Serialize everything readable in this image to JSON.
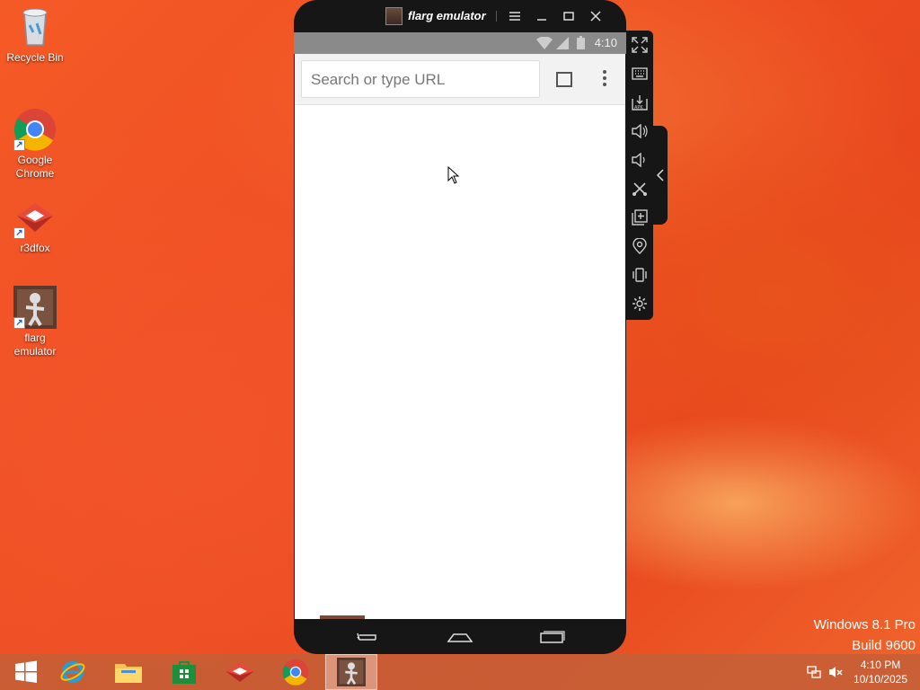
{
  "desktop": {
    "icons": [
      {
        "label": "Recycle Bin"
      },
      {
        "label": "Google Chrome"
      },
      {
        "label": "r3dfox"
      },
      {
        "label": "flarg emulator"
      }
    ],
    "watermark": {
      "line1": "Windows 8.1 Pro",
      "line2": "Build 9600"
    }
  },
  "emulator": {
    "title": "flarg emulator",
    "status_time": "4:10",
    "browser": {
      "url_placeholder": "Search or type URL"
    },
    "side_toolbar": [
      "fullscreen-icon",
      "keyboard-icon",
      "apk-install-icon",
      "volume-up-icon",
      "volume-down-icon",
      "screenshot-cut-icon",
      "multi-instance-icon",
      "location-icon",
      "shake-icon",
      "settings-icon"
    ]
  },
  "taskbar": {
    "items": [
      "start-button",
      "internet-explorer",
      "file-explorer",
      "windows-store",
      "r3dfox",
      "google-chrome",
      "flarg-emulator"
    ],
    "clock": {
      "time": "4:10 PM",
      "date": "10/10/2025"
    }
  }
}
